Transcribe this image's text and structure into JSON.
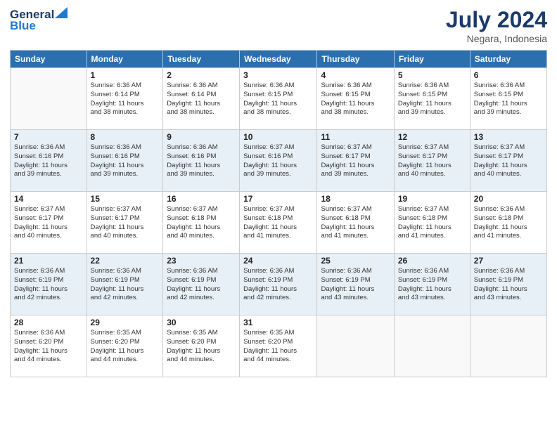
{
  "logo": {
    "general": "General",
    "blue": "Blue"
  },
  "header": {
    "month": "July 2024",
    "location": "Negara, Indonesia"
  },
  "weekdays": [
    "Sunday",
    "Monday",
    "Tuesday",
    "Wednesday",
    "Thursday",
    "Friday",
    "Saturday"
  ],
  "weeks": [
    [
      {
        "day": "",
        "info": ""
      },
      {
        "day": "1",
        "info": "Sunrise: 6:36 AM\nSunset: 6:14 PM\nDaylight: 11 hours\nand 38 minutes."
      },
      {
        "day": "2",
        "info": "Sunrise: 6:36 AM\nSunset: 6:14 PM\nDaylight: 11 hours\nand 38 minutes."
      },
      {
        "day": "3",
        "info": "Sunrise: 6:36 AM\nSunset: 6:15 PM\nDaylight: 11 hours\nand 38 minutes."
      },
      {
        "day": "4",
        "info": "Sunrise: 6:36 AM\nSunset: 6:15 PM\nDaylight: 11 hours\nand 38 minutes."
      },
      {
        "day": "5",
        "info": "Sunrise: 6:36 AM\nSunset: 6:15 PM\nDaylight: 11 hours\nand 39 minutes."
      },
      {
        "day": "6",
        "info": "Sunrise: 6:36 AM\nSunset: 6:15 PM\nDaylight: 11 hours\nand 39 minutes."
      }
    ],
    [
      {
        "day": "7",
        "info": "Sunrise: 6:36 AM\nSunset: 6:16 PM\nDaylight: 11 hours\nand 39 minutes."
      },
      {
        "day": "8",
        "info": "Sunrise: 6:36 AM\nSunset: 6:16 PM\nDaylight: 11 hours\nand 39 minutes."
      },
      {
        "day": "9",
        "info": "Sunrise: 6:36 AM\nSunset: 6:16 PM\nDaylight: 11 hours\nand 39 minutes."
      },
      {
        "day": "10",
        "info": "Sunrise: 6:37 AM\nSunset: 6:16 PM\nDaylight: 11 hours\nand 39 minutes."
      },
      {
        "day": "11",
        "info": "Sunrise: 6:37 AM\nSunset: 6:17 PM\nDaylight: 11 hours\nand 39 minutes."
      },
      {
        "day": "12",
        "info": "Sunrise: 6:37 AM\nSunset: 6:17 PM\nDaylight: 11 hours\nand 40 minutes."
      },
      {
        "day": "13",
        "info": "Sunrise: 6:37 AM\nSunset: 6:17 PM\nDaylight: 11 hours\nand 40 minutes."
      }
    ],
    [
      {
        "day": "14",
        "info": "Sunrise: 6:37 AM\nSunset: 6:17 PM\nDaylight: 11 hours\nand 40 minutes."
      },
      {
        "day": "15",
        "info": "Sunrise: 6:37 AM\nSunset: 6:17 PM\nDaylight: 11 hours\nand 40 minutes."
      },
      {
        "day": "16",
        "info": "Sunrise: 6:37 AM\nSunset: 6:18 PM\nDaylight: 11 hours\nand 40 minutes."
      },
      {
        "day": "17",
        "info": "Sunrise: 6:37 AM\nSunset: 6:18 PM\nDaylight: 11 hours\nand 41 minutes."
      },
      {
        "day": "18",
        "info": "Sunrise: 6:37 AM\nSunset: 6:18 PM\nDaylight: 11 hours\nand 41 minutes."
      },
      {
        "day": "19",
        "info": "Sunrise: 6:37 AM\nSunset: 6:18 PM\nDaylight: 11 hours\nand 41 minutes."
      },
      {
        "day": "20",
        "info": "Sunrise: 6:36 AM\nSunset: 6:18 PM\nDaylight: 11 hours\nand 41 minutes."
      }
    ],
    [
      {
        "day": "21",
        "info": "Sunrise: 6:36 AM\nSunset: 6:19 PM\nDaylight: 11 hours\nand 42 minutes."
      },
      {
        "day": "22",
        "info": "Sunrise: 6:36 AM\nSunset: 6:19 PM\nDaylight: 11 hours\nand 42 minutes."
      },
      {
        "day": "23",
        "info": "Sunrise: 6:36 AM\nSunset: 6:19 PM\nDaylight: 11 hours\nand 42 minutes."
      },
      {
        "day": "24",
        "info": "Sunrise: 6:36 AM\nSunset: 6:19 PM\nDaylight: 11 hours\nand 42 minutes."
      },
      {
        "day": "25",
        "info": "Sunrise: 6:36 AM\nSunset: 6:19 PM\nDaylight: 11 hours\nand 43 minutes."
      },
      {
        "day": "26",
        "info": "Sunrise: 6:36 AM\nSunset: 6:19 PM\nDaylight: 11 hours\nand 43 minutes."
      },
      {
        "day": "27",
        "info": "Sunrise: 6:36 AM\nSunset: 6:19 PM\nDaylight: 11 hours\nand 43 minutes."
      }
    ],
    [
      {
        "day": "28",
        "info": "Sunrise: 6:36 AM\nSunset: 6:20 PM\nDaylight: 11 hours\nand 44 minutes."
      },
      {
        "day": "29",
        "info": "Sunrise: 6:35 AM\nSunset: 6:20 PM\nDaylight: 11 hours\nand 44 minutes."
      },
      {
        "day": "30",
        "info": "Sunrise: 6:35 AM\nSunset: 6:20 PM\nDaylight: 11 hours\nand 44 minutes."
      },
      {
        "day": "31",
        "info": "Sunrise: 6:35 AM\nSunset: 6:20 PM\nDaylight: 11 hours\nand 44 minutes."
      },
      {
        "day": "",
        "info": ""
      },
      {
        "day": "",
        "info": ""
      },
      {
        "day": "",
        "info": ""
      }
    ]
  ]
}
